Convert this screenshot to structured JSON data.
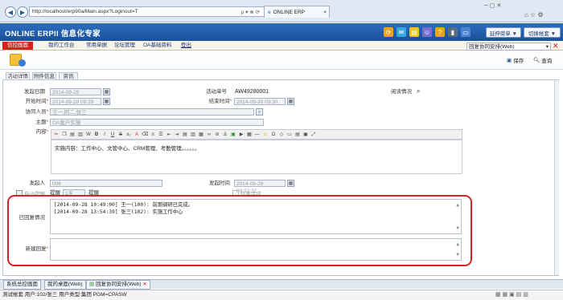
{
  "browser": {
    "address": "http://localhost/erp90a/Main.aspx?Loginout=T",
    "tab_title": "ONLINE ERP",
    "search_glyph": "ρ ▾ ⊗ ⟳"
  },
  "app": {
    "logo": "ONLINE ERPII 信息化专家",
    "buttons": {
      "switch_menu": "延伸菜单 ▼",
      "switch_account": "切换帐套 ▼"
    }
  },
  "menu": {
    "items": [
      "信控画面",
      "我的工作台",
      "常用单据",
      "论坛管理",
      "OA基础资料",
      "登出"
    ]
  },
  "toolbar": {
    "select_value": "回复协同安排(Web)",
    "save_label": "保存",
    "query_label": "查询"
  },
  "form_tabs": [
    "活动详情",
    "附件信息",
    "资讯"
  ],
  "form": {
    "start_date_label": "发起日期",
    "start_date_value": "2014-09-28",
    "begin_time_label": "开始时间",
    "begin_time_value": "2014-09-28 09:29",
    "assistant_label": "协同人员",
    "assistant_value": "王一,阿二,张三",
    "subject_label": "主题",
    "subject_value": "OA案户实施",
    "content_label": "内容",
    "activity_no_label": "活动单号",
    "activity_no_value": "AW49280001",
    "end_time_label": "结束时间",
    "end_time_value": "2014-09-30 09:30",
    "read_status_label": "阅读情况",
    "content_text": "实施内容：工作中心、文管中心、CRM管理、考勤管理。。。。。。",
    "initiator_label": "发起人",
    "initiator_value": "006",
    "start_time_label": "发起时间",
    "start_time_value": "2014-09-28 09:32:22",
    "auto_notify_label": "自动提醒",
    "remind_label": "提醒",
    "remind_value": "1天",
    "remind_unit": "提醒",
    "completed_label": "任务完成",
    "replied_label": "已回复情况",
    "replies": [
      "[2014-09-28 10:49:00] 王一(100): 前期调研已完成。",
      "[2014-09-28 13:54:39] 张三(102): 实施工作中心"
    ],
    "new_reply_label": "新建回复"
  },
  "bottom_tabs": [
    "系统总控画面",
    "我的桌面(Web)",
    "回复协同安排(Web)"
  ],
  "status": {
    "text": "测试帐套  用户:102/张三  用户类型:集团  PGM=CPASW"
  },
  "colors": {
    "header_blue": "#1b4f9a",
    "menu_red": "#d9201d",
    "highlight_red": "#d8232a"
  }
}
